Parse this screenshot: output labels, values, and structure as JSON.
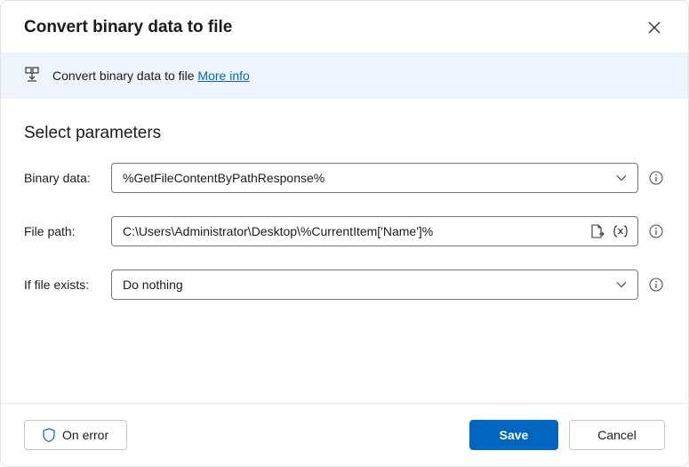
{
  "header": {
    "title": "Convert binary data to file"
  },
  "banner": {
    "text": "Convert binary data to file ",
    "link": "More info"
  },
  "section": {
    "title": "Select parameters"
  },
  "fields": {
    "binary": {
      "label": "Binary data:",
      "value": "%GetFileContentByPathResponse%"
    },
    "filepath": {
      "label": "File path:",
      "value": "C:\\Users\\Administrator\\Desktop\\%CurrentItem['Name']%"
    },
    "exists": {
      "label": "If file exists:",
      "value": "Do nothing"
    }
  },
  "footer": {
    "on_error": "On error",
    "save": "Save",
    "cancel": "Cancel"
  }
}
